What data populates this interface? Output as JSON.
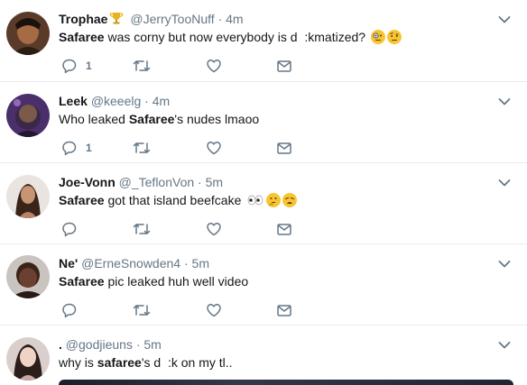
{
  "tweets": [
    {
      "name": "Trophae",
      "handle": "@JerryTooNuff",
      "dot": "·",
      "time": "4m",
      "text_before": "",
      "text_bold": "Safaree",
      "text_after": " was corny but now everybody is d  :kmatized?",
      "reply_count": "1",
      "retweet_count": "",
      "like_count": ""
    },
    {
      "name": "Leek",
      "handle": "@keeelg",
      "dot": "·",
      "time": "4m",
      "text_before": "Who leaked ",
      "text_bold": "Safaree",
      "text_after": "'s nudes lmaoo",
      "reply_count": "1",
      "retweet_count": "",
      "like_count": ""
    },
    {
      "name": "Joe-Vonn",
      "handle": "@_TeflonVon",
      "dot": "·",
      "time": "5m",
      "text_before": "",
      "text_bold": "Safaree",
      "text_after": " got that island beefcake",
      "reply_count": "",
      "retweet_count": "",
      "like_count": ""
    },
    {
      "name": "Ne'",
      "handle": "@ErneSnowden4",
      "dot": "·",
      "time": "5m",
      "text_before": "",
      "text_bold": "Safaree",
      "text_after": " pic leaked huh well video",
      "reply_count": "",
      "retweet_count": "",
      "like_count": ""
    },
    {
      "name": ".",
      "handle": "@godjieuns",
      "dot": "·",
      "time": "5m",
      "text_before": "why is ",
      "text_bold": "safaree",
      "text_after": "'s d  :k on my tl..",
      "reply_count": "",
      "retweet_count": "",
      "like_count": ""
    }
  ],
  "colors": {
    "icon_gray": "#657786",
    "divider": "#e6ecf0",
    "name": "#14171a"
  },
  "icons": [
    "reply-icon",
    "retweet-icon",
    "like-icon",
    "dm-icon",
    "chevron-down-icon",
    "trophy-icon"
  ]
}
